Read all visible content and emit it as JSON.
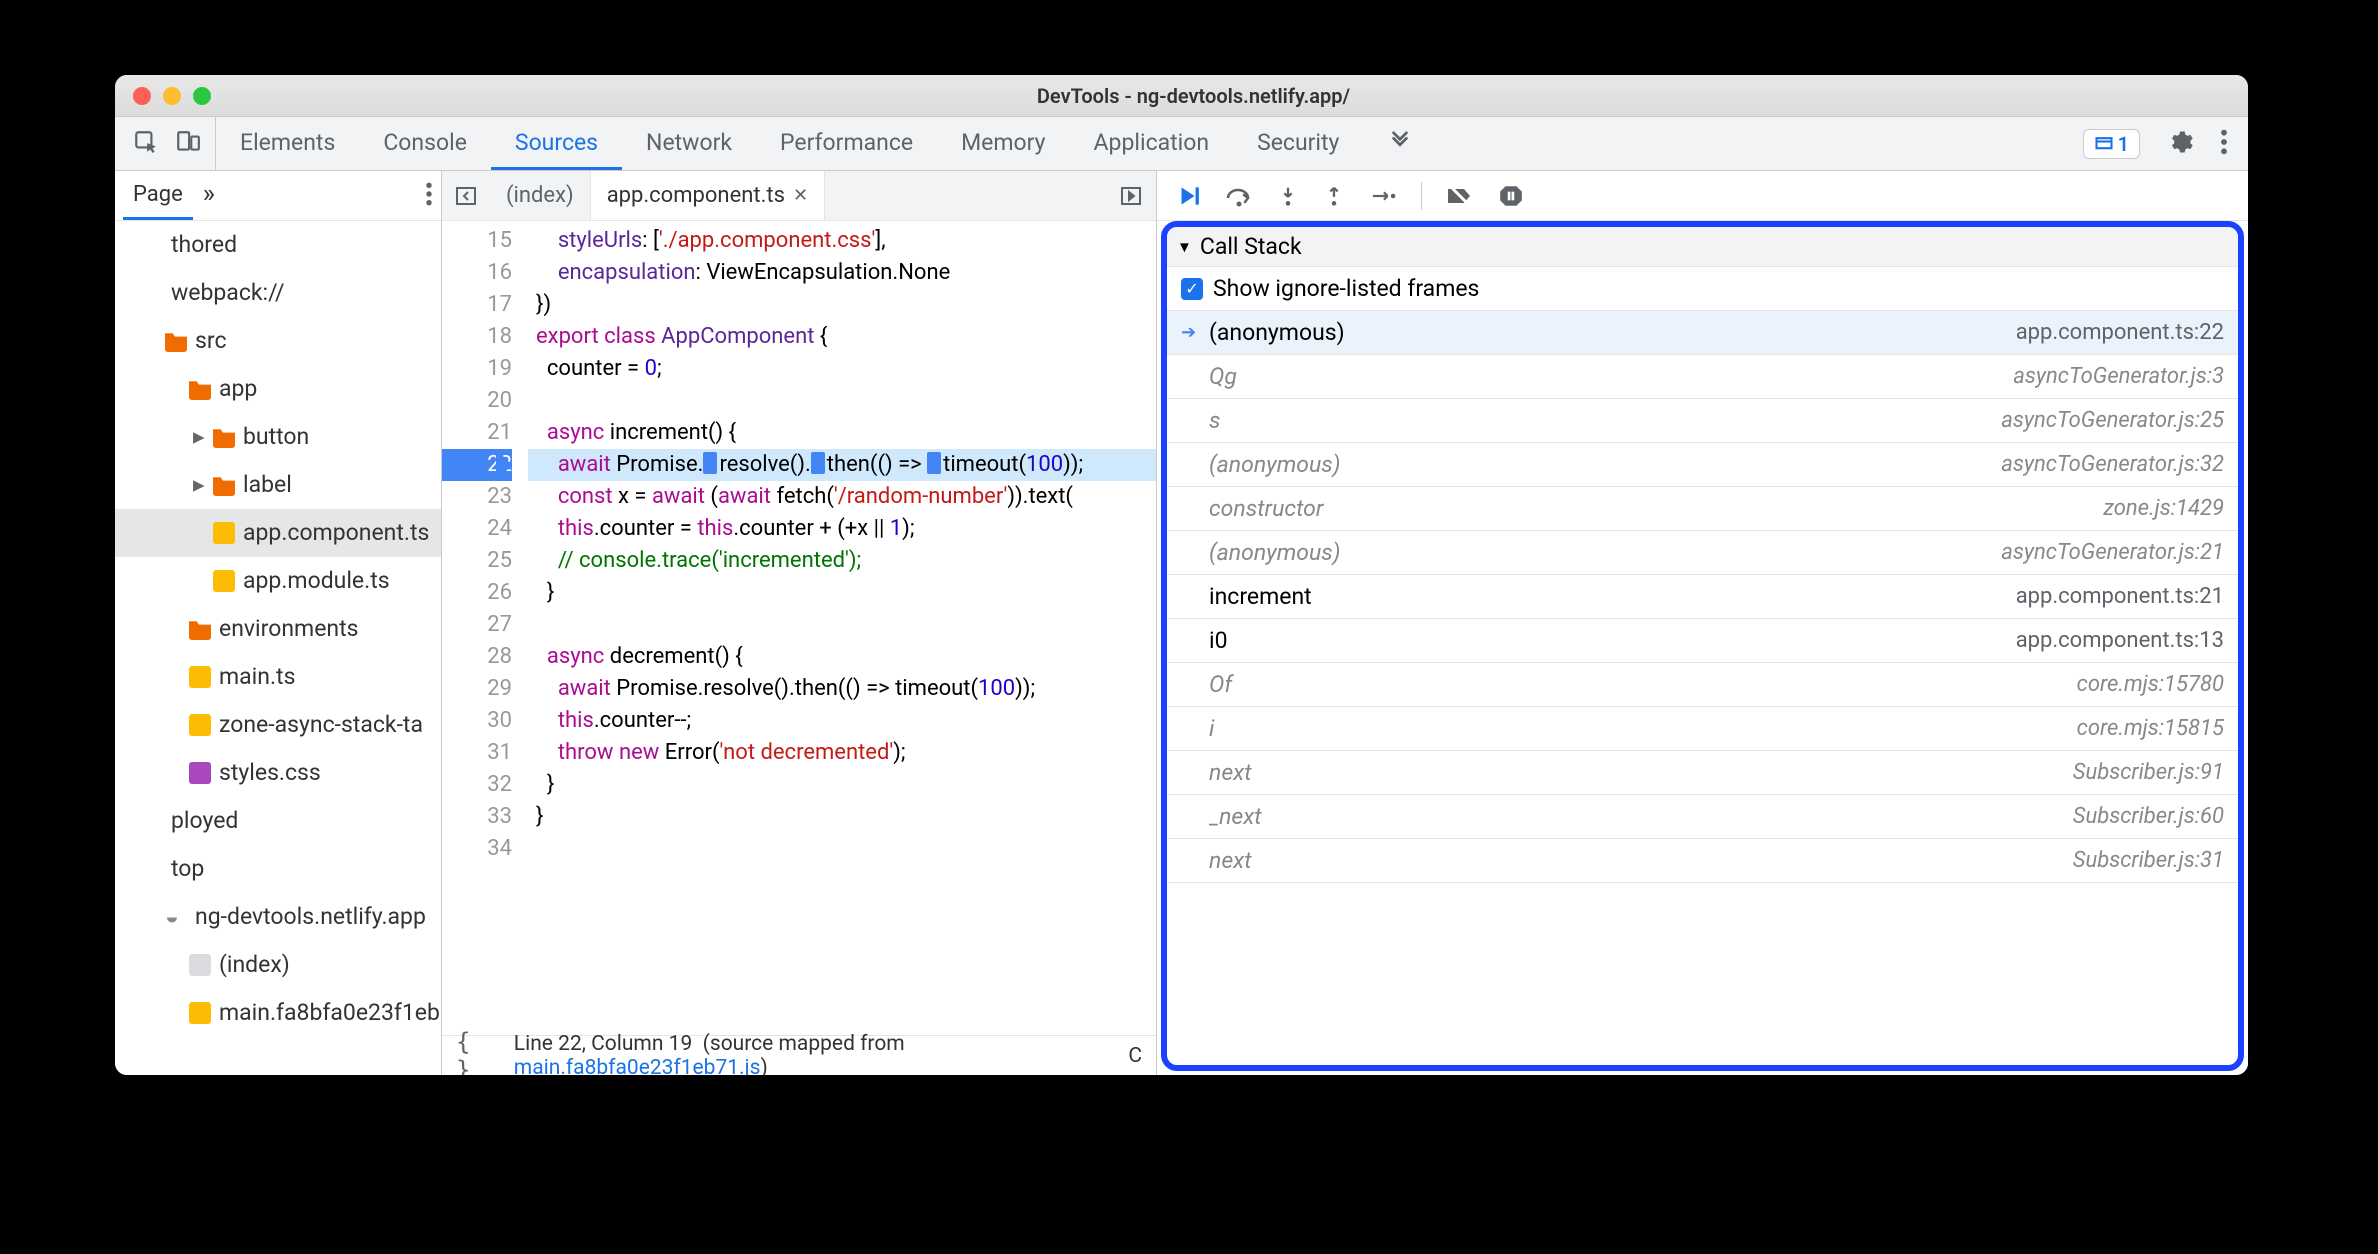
{
  "window": {
    "title": "DevTools - ng-devtools.netlify.app/"
  },
  "tabs": {
    "items": [
      "Elements",
      "Console",
      "Sources",
      "Network",
      "Performance",
      "Memory",
      "Application",
      "Security"
    ],
    "active_index": 2,
    "issues_count": "1"
  },
  "sidebar": {
    "tab": "Page",
    "tree": [
      {
        "indent": 0,
        "icon": "",
        "label": "thored",
        "selectable": false
      },
      {
        "indent": 0,
        "icon": "",
        "label": "webpack://",
        "selectable": false
      },
      {
        "indent": 1,
        "icon": "folder",
        "label": "src",
        "tri": ""
      },
      {
        "indent": 2,
        "icon": "folder",
        "label": "app",
        "tri": ""
      },
      {
        "indent": 3,
        "icon": "folder",
        "label": "button",
        "tri": "▸"
      },
      {
        "indent": 3,
        "icon": "folder",
        "label": "label",
        "tri": "▸"
      },
      {
        "indent": 3,
        "icon": "file-y",
        "label": "app.component.ts",
        "selected": true
      },
      {
        "indent": 3,
        "icon": "file-y",
        "label": "app.module.ts"
      },
      {
        "indent": 2,
        "icon": "folder",
        "label": "environments",
        "tri": ""
      },
      {
        "indent": 2,
        "icon": "file-y",
        "label": "main.ts"
      },
      {
        "indent": 2,
        "icon": "file-y",
        "label": "zone-async-stack-ta"
      },
      {
        "indent": 2,
        "icon": "file-p",
        "label": "styles.css"
      },
      {
        "indent": 0,
        "icon": "",
        "label": "ployed"
      },
      {
        "indent": 0,
        "icon": "",
        "label": "top"
      },
      {
        "indent": 1,
        "icon": "cloud",
        "label": "ng-devtools.netlify.app"
      },
      {
        "indent": 2,
        "icon": "file-g",
        "label": "(index)"
      },
      {
        "indent": 2,
        "icon": "file-y",
        "label": "main.fa8bfa0e23f1eb"
      }
    ]
  },
  "editor": {
    "tabs": [
      {
        "label": "(index)",
        "active": false,
        "closeable": false
      },
      {
        "label": "app.component.ts",
        "active": true,
        "closeable": true
      }
    ],
    "first_line_no": 15,
    "breakpoint_line_no": 22,
    "lines": [
      {
        "n": 15,
        "html": "    <span class='cls'>styleUrls</span>: [<span class='str'>'./app.component.css'</span>],"
      },
      {
        "n": 16,
        "html": "    <span class='cls'>encapsulation</span>: ViewEncapsulation.None"
      },
      {
        "n": 17,
        "html": "})"
      },
      {
        "n": 18,
        "html": "<span class='kw'>export</span> <span class='kw'>class</span> <span class='cls'>AppComponent</span> {"
      },
      {
        "n": 19,
        "html": "  counter = <span class='num'>0</span>;"
      },
      {
        "n": 20,
        "html": ""
      },
      {
        "n": 21,
        "html": "  <span class='kw'>async</span> increment() {"
      },
      {
        "n": 22,
        "hl": true,
        "html": "    <span class='kw'>await</span> Promise.<span class='step'></span>resolve().<span class='step'></span>then(() =&gt; <span class='step'></span>timeout(<span class='num'>100</span>));"
      },
      {
        "n": 23,
        "html": "    <span class='kw'>const</span> x = <span class='kw'>await</span> (<span class='kw'>await</span> fetch(<span class='str'>'/random-number'</span>)).text("
      },
      {
        "n": 24,
        "html": "    <span class='kw'>this</span>.counter = <span class='kw'>this</span>.counter + (+x || <span class='num'>1</span>);"
      },
      {
        "n": 25,
        "html": "    <span class='cmt'>// console.trace('incremented');</span>"
      },
      {
        "n": 26,
        "html": "  }"
      },
      {
        "n": 27,
        "html": ""
      },
      {
        "n": 28,
        "html": "  <span class='kw'>async</span> decrement() {"
      },
      {
        "n": 29,
        "html": "    <span class='kw'>await</span> Promise.resolve().then(() =&gt; timeout(<span class='num'>100</span>));"
      },
      {
        "n": 30,
        "html": "    <span class='kw'>this</span>.counter--;"
      },
      {
        "n": 31,
        "html": "    <span class='kw'>throw</span> <span class='kw'>new</span> Error(<span class='str'>'not decremented'</span>);"
      },
      {
        "n": 32,
        "html": "  }"
      },
      {
        "n": 33,
        "html": "}"
      },
      {
        "n": 34,
        "html": ""
      }
    ],
    "status": {
      "pos": "Line 22, Column 19",
      "mapped_prefix": "(source mapped from ",
      "mapped_link": "main.fa8bfa0e23f1eb71.js",
      "mapped_suffix": ")",
      "coverage": "C"
    }
  },
  "debugger": {
    "section_title": "Call Stack",
    "show_ignored_label": "Show ignore-listed frames",
    "frames": [
      {
        "fn": "(anonymous)",
        "loc": "app.component.ts:22",
        "current": true,
        "ignored": false
      },
      {
        "fn": "Qg",
        "loc": "asyncToGenerator.js:3",
        "ignored": true
      },
      {
        "fn": "s",
        "loc": "asyncToGenerator.js:25",
        "ignored": true
      },
      {
        "fn": "(anonymous)",
        "loc": "asyncToGenerator.js:32",
        "ignored": true
      },
      {
        "fn": "constructor",
        "loc": "zone.js:1429",
        "ignored": true
      },
      {
        "fn": "(anonymous)",
        "loc": "asyncToGenerator.js:21",
        "ignored": true
      },
      {
        "fn": "increment",
        "loc": "app.component.ts:21",
        "ignored": false
      },
      {
        "fn": "i0",
        "loc": "app.component.ts:13",
        "ignored": false
      },
      {
        "fn": "Of",
        "loc": "core.mjs:15780",
        "ignored": true
      },
      {
        "fn": "i",
        "loc": "core.mjs:15815",
        "ignored": true
      },
      {
        "fn": "next",
        "loc": "Subscriber.js:91",
        "ignored": true
      },
      {
        "fn": "_next",
        "loc": "Subscriber.js:60",
        "ignored": true
      },
      {
        "fn": "next",
        "loc": "Subscriber.js:31",
        "ignored": true
      }
    ]
  }
}
